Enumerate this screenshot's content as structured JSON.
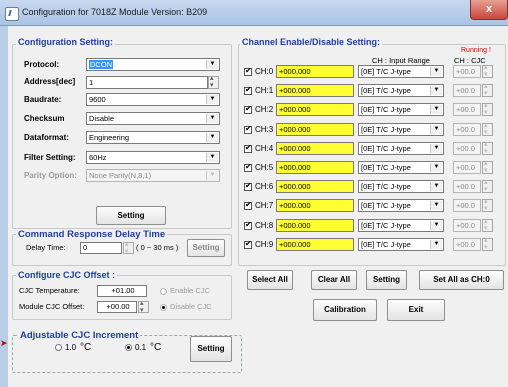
{
  "window": {
    "title": "Configuration for 7018Z Module Version: B209",
    "close_label": "x"
  },
  "config": {
    "title": "Configuration Setting:",
    "protocol": {
      "label": "Protocol:",
      "value": "DCON"
    },
    "address": {
      "label": "Address[dec]",
      "value": "1"
    },
    "baudrate": {
      "label": "Baudrate:",
      "value": "9600"
    },
    "checksum": {
      "label": "Checksum",
      "value": "Disable"
    },
    "dataformat": {
      "label": "Dataformat:",
      "value": "Engineering"
    },
    "filter": {
      "label": "Filter Setting:",
      "value": "60Hz"
    },
    "parity": {
      "label": "Parity Option:",
      "value": "None Parity(N,8,1)"
    },
    "setting_label": "Setting"
  },
  "delay": {
    "title": "Command Response Delay Time",
    "label": "Delay Time:",
    "value": "0",
    "range": "( 0 ~ 30 ms )",
    "setting_label": "Setting"
  },
  "cjc": {
    "title": "Configure CJC Offset :",
    "temp_label": "CJC Temperature:",
    "temp_value": "+01.00",
    "offset_label": "Module CJC Offset:",
    "offset_value": "+00.00",
    "enable_label": "Enable CJC",
    "disable_label": "Disable CJC"
  },
  "increment": {
    "title": "Adjustable CJC Increment",
    "opt1": "1.0",
    "opt2": "0.1",
    "unit": "°C",
    "setting_label": "Setting"
  },
  "channels": {
    "title": "Channel Enable/Disable Setting:",
    "running": "Running !",
    "col_range": "CH : Input Range",
    "col_cjc": "CH : CJC",
    "items": [
      {
        "label": "CH:0",
        "value": "+000.000",
        "range": "[0E] T/C J-type",
        "cjc": "+00.0"
      },
      {
        "label": "CH:1",
        "value": "+000.000",
        "range": "[0E] T/C J-type",
        "cjc": "+00.0"
      },
      {
        "label": "CH:2",
        "value": "+000.000",
        "range": "[0E] T/C J-type",
        "cjc": "+00.0"
      },
      {
        "label": "CH:3",
        "value": "+000.000",
        "range": "[0E] T/C J-type",
        "cjc": "+00.0"
      },
      {
        "label": "CH:4",
        "value": "+000.000",
        "range": "[0E] T/C J-type",
        "cjc": "+00.0"
      },
      {
        "label": "CH:5",
        "value": "+000.000",
        "range": "[0E] T/C J-type",
        "cjc": "+00.0"
      },
      {
        "label": "CH:6",
        "value": "+000.000",
        "range": "[0E] T/C J-type",
        "cjc": "+00.0"
      },
      {
        "label": "CH:7",
        "value": "+000.000",
        "range": "[0E] T/C J-type",
        "cjc": "+00.0"
      },
      {
        "label": "CH:8",
        "value": "+000.000",
        "range": "[0E] T/C J-type",
        "cjc": "+00.0"
      },
      {
        "label": "CH:9",
        "value": "+000.000",
        "range": "[0E] T/C J-type",
        "cjc": "+00.0"
      }
    ]
  },
  "actions": {
    "select_all": "Select All",
    "clear_all": "Clear All",
    "setting": "Setting",
    "set_all": "Set All as CH:0",
    "calibration": "Calibration",
    "exit": "Exit"
  }
}
